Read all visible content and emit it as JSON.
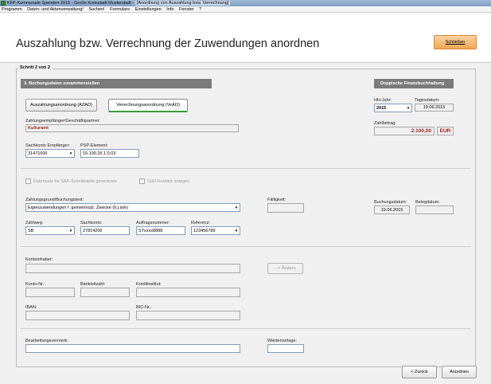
{
  "window": {
    "title_prefix": "KFP-Kommunale Spenden 2015 - Große Kreisstadt Musterstadt - ",
    "title_doc": "[Anordnung von Auszahlung bzw. Verrechnung]"
  },
  "menu": [
    "Programm",
    "Daten- und Aktenverwaltung!",
    "Suchen!",
    "Formulare",
    "Einstellungen",
    "Info",
    "Fenster",
    "?"
  ],
  "header": {
    "title": "Auszahlung bzw. Verrechnung der Zuwendungen anordnen",
    "close_label": "Schließen"
  },
  "step": "Schritt 2 von 2",
  "sections": {
    "booking": "3. Buchungsdaten zusammenstellen",
    "doppik": "Doppische Finanzbuchhaltung"
  },
  "buttons": {
    "azao": "Auszahlungsanordnung (AZAO)",
    "veao": "Verrechnungsanordnung (VeAO)",
    "change": "--> Ändern",
    "back": "< Zurück",
    "order": "Anordnen"
  },
  "fields": {
    "recipient_label": "Zahlungsempfänger/Geschäftspartner:",
    "recipient_value": "Kulturamt",
    "account_recipient_label": "Sachkonto Empfänger:",
    "account_recipient_value": "31471000",
    "psp_label": "PSP-Element:",
    "psp_value": "10.100.26.1.0.03",
    "hh_year_label": "HH-Jahr:",
    "hh_year_value": "2015",
    "day_date_label": "Tagesdatum:",
    "day_date_value": "19.06.2015",
    "amount_label": "Zahlbetrag:",
    "amount_value": "2.100,00",
    "amount_currency": "EUR",
    "sap_checkbox": "Datensatz für SAP-Schnittstelle generieren",
    "cpd_checkbox": "CpD-Kreditor anlegen",
    "reason_label": "Zahlungsgrund/Buchungstext:",
    "reason_value": "Eigenzuwendungen f. gemeinnütz. Zwecke (lt.Liste)",
    "due_label": "Fälligkeit:",
    "due_value": "",
    "booking_date_label": "Buchungsdatum:",
    "booking_date_value": "19.06.2015",
    "receipt_date_label": "Belegdatum:",
    "receipt_date_value": "",
    "payment_method_label": "Zahlweg:",
    "payment_method_value": "SB",
    "account_label": "Sachkonto:",
    "account_value": "27814206",
    "order_no_label": "Auftragsnummer:",
    "order_no_value": "STxxxx8888",
    "reference_label": "Referenz:",
    "reference_value": "123456789",
    "holder_label": "Kontoinhaber:",
    "holder_value": "",
    "account_no_label": "Konto-Nr.:",
    "account_no_value": "",
    "bank_code_label": "Bankleitzahl:",
    "bank_code_value": "",
    "bank_label": "Kreditinstitut:",
    "bank_value": "",
    "iban_label": "IBAN:",
    "iban_value": "",
    "bic_label": "BIC-Nr.:",
    "bic_value": "",
    "note_label": "Bearbeitungsvermerk:",
    "note_value": "",
    "resubmission_label": "Wiedervorlage:",
    "resubmission_value": ""
  },
  "colors": {
    "amount": "#9b1c1c",
    "close_button": "#f2a654",
    "section": "#7b7b7b",
    "active_tab": "#3a9b3a"
  }
}
